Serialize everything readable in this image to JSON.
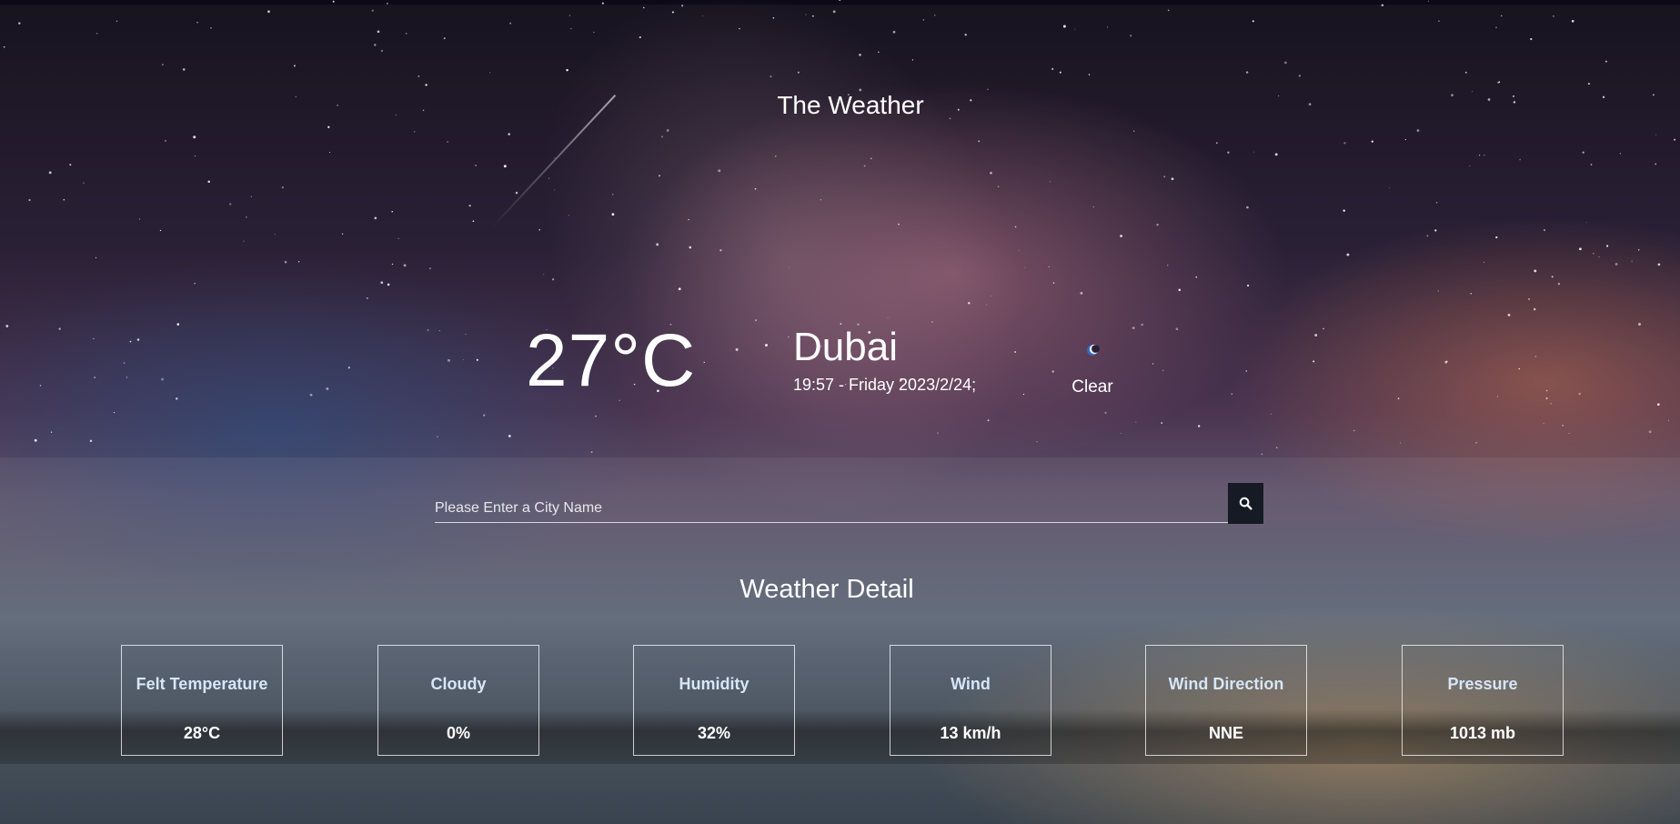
{
  "app": {
    "title": "The Weather"
  },
  "current": {
    "temperature": "27°C",
    "city": "Dubai",
    "datetime": "19:57 - Friday 2023/2/24;",
    "condition": "Clear",
    "condition_icon": "moon-icon"
  },
  "search": {
    "placeholder": "Please Enter a City Name",
    "value": "",
    "button_icon": "search-icon"
  },
  "details": {
    "title": "Weather Detail",
    "cards": [
      {
        "label": "Felt Temperature",
        "value": "28°C"
      },
      {
        "label": "Cloudy",
        "value": "0%"
      },
      {
        "label": "Humidity",
        "value": "32%"
      },
      {
        "label": "Wind",
        "value": "13 km/h"
      },
      {
        "label": "Wind Direction",
        "value": "NNE"
      },
      {
        "label": "Pressure",
        "value": "1013 mb"
      }
    ]
  },
  "colors": {
    "card_border": "#ffffff",
    "card_label": "#d6e6f8",
    "search_button": "#161a25",
    "text": "#ffffff"
  }
}
